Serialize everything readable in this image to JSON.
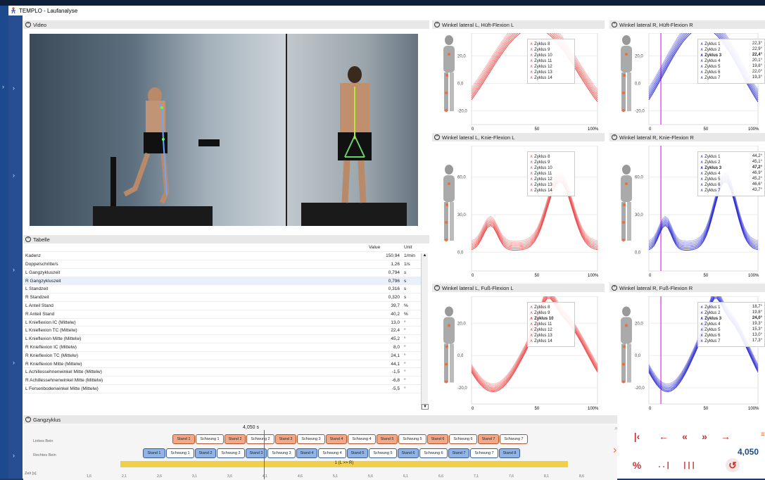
{
  "app": {
    "title": "TEMPLO - Laufanalyse"
  },
  "panels": {
    "video": "Video",
    "tabelle": "Tabelle",
    "gangzyklus": "Gangzyklus"
  },
  "table": {
    "headers": [
      "Value",
      "Unit"
    ],
    "rows": [
      [
        "Kadenz",
        "150,94",
        "1/min"
      ],
      [
        "Doppelschritte/s",
        "1,26",
        "1/s"
      ],
      [
        "L Gangzykluszeit",
        "0,794",
        "s"
      ],
      [
        "R Gangzykluszeit",
        "0,796",
        "s"
      ],
      [
        "L Standzeit",
        "0,316",
        "s"
      ],
      [
        "R Standzeit",
        "0,320",
        "s"
      ],
      [
        "L Anteil Stand",
        "39,7",
        "%"
      ],
      [
        "R Anteil Stand",
        "40,2",
        "%"
      ],
      [
        "L Knieflexion IC (Mittelw)",
        "13,0",
        "°"
      ],
      [
        "L Knieflexion TC (Mittelw)",
        "22,4",
        "°"
      ],
      [
        "L Knieflexion Mitte (Mittelw)",
        "45,2",
        "°"
      ],
      [
        "R Knieflexion IC (Mittelw)",
        "8,0",
        "°"
      ],
      [
        "R Knieflexion TC (Mittelw)",
        "24,1",
        "°"
      ],
      [
        "R Knieflexion Mitte (Mittelw)",
        "44,1",
        "°"
      ],
      [
        "L Achillessehnenwinkel Mitte (Mittelw)",
        "-1,5",
        "°"
      ],
      [
        "R Achillessehnenwinkel Mitte (Mittelw)",
        "-6,8",
        "°"
      ],
      [
        "L Fersenbodenwinkel Mitte (Mittelw)",
        "-5,5",
        "°"
      ]
    ]
  },
  "charts": [
    {
      "title": "Winkel lateral L, Hüft-Flexion L",
      "side": "L",
      "yt": [
        "20,0",
        "0,0",
        "-20,0"
      ],
      "xt": [
        "0",
        "50",
        "100%"
      ],
      "leg": [
        "Zyklus 8",
        "Zyklus 9",
        "Zyklus 10",
        "Zyklus 11",
        "Zyklus 12",
        "Zyklus 13",
        "Zyklus 14"
      ],
      "vals": []
    },
    {
      "title": "Winkel lateral R, Hüft-Flexion R",
      "side": "R",
      "yt": [
        "20,0",
        "0,0",
        "-20,0"
      ],
      "xt": [
        "0",
        "50",
        "100%"
      ],
      "leg": [
        "Zyklus 1",
        "Zyklus 2",
        "Zyklus 3",
        "Zyklus 4",
        "Zyklus 5",
        "Zyklus 6",
        "Zyklus 7"
      ],
      "vals": [
        "22,3°",
        "22,9°",
        "22,4°",
        "20,1°",
        "19,8°",
        "22,0°",
        "19,3°"
      ]
    },
    {
      "title": "Winkel lateral L, Knie-Flexion L",
      "side": "L",
      "yt": [
        "60,0",
        "30,0",
        "0,0"
      ],
      "xt": [
        "0",
        "50",
        "100%"
      ],
      "leg": [
        "Zyklus 8",
        "Zyklus 9",
        "Zyklus 10",
        "Zyklus 11",
        "Zyklus 12",
        "Zyklus 13",
        "Zyklus 14"
      ],
      "vals": []
    },
    {
      "title": "Winkel lateral R, Knie-Flexion R",
      "side": "R",
      "yt": [
        "60,0",
        "30,0",
        "0,0"
      ],
      "xt": [
        "0",
        "50",
        "100%"
      ],
      "leg": [
        "Zyklus 1",
        "Zyklus 2",
        "Zyklus 3",
        "Zyklus 4",
        "Zyklus 5",
        "Zyklus 6",
        "Zyklus 7"
      ],
      "vals": [
        "44,2°",
        "45,1°",
        "47,2°",
        "46,9°",
        "45,2°",
        "46,6°",
        "43,7°"
      ]
    },
    {
      "title": "Winkel lateral L, Fuß-Flexion L",
      "side": "L",
      "yt": [
        "20,0",
        "0,0",
        "-20,0"
      ],
      "xt": [
        "0",
        "50",
        "100%"
      ],
      "leg": [
        "Zyklus 8",
        "Zyklus 9",
        "Zyklus 10",
        "Zyklus 11",
        "Zyklus 12",
        "Zyklus 13",
        "Zyklus 14"
      ],
      "vals": []
    },
    {
      "title": "Winkel lateral R, Fuß-Flexion R",
      "side": "R",
      "yt": [
        "20,0",
        "0,0",
        "-20,0"
      ],
      "xt": [
        "0",
        "50",
        "100%"
      ],
      "leg": [
        "Zyklus 1",
        "Zyklus 2",
        "Zyklus 3",
        "Zyklus 4",
        "Zyklus 5",
        "Zyklus 6",
        "Zyklus 7"
      ],
      "vals": [
        "18,7°",
        "19,8°",
        "24,0°",
        "19,3°",
        "15,3°",
        "13,0°",
        "17,3°"
      ]
    }
  ],
  "gait": {
    "time_label": "4,050 s",
    "left_label": "Linkes Bein",
    "right_label": "Rechtes Bein",
    "zeit_label": "Zeit [s]",
    "left": [
      "Stand 1",
      "Schwung 1",
      "Stand 2",
      "Schwung 2",
      "Stand 3",
      "Schwung 3",
      "Stand 4",
      "Schwung 4",
      "Stand 5",
      "Schwung 5",
      "Stand 6",
      "Schwung 6",
      "Stand 7",
      "Schwung 7"
    ],
    "right": [
      "Stand 1",
      "Schwung 1",
      "Stand 2",
      "Schwung 2",
      "Stand 3",
      "Schwung 3",
      "Stand 4",
      "Schwung 4",
      "Stand 5",
      "Schwung 5",
      "Stand 6",
      "Schwung 6",
      "Stand 7",
      "Schwung 7",
      "Stand 8"
    ],
    "yellow": "1 (L >> R)",
    "ticks": [
      "1,6",
      "2,1",
      "2,6",
      "3,1",
      "3,6",
      "4,1",
      "4,6",
      "5,1",
      "5,6",
      "6,1",
      "6,6",
      "7,1",
      "7,6",
      "8,1",
      "8,6"
    ],
    "time_display": "4,050"
  }
}
